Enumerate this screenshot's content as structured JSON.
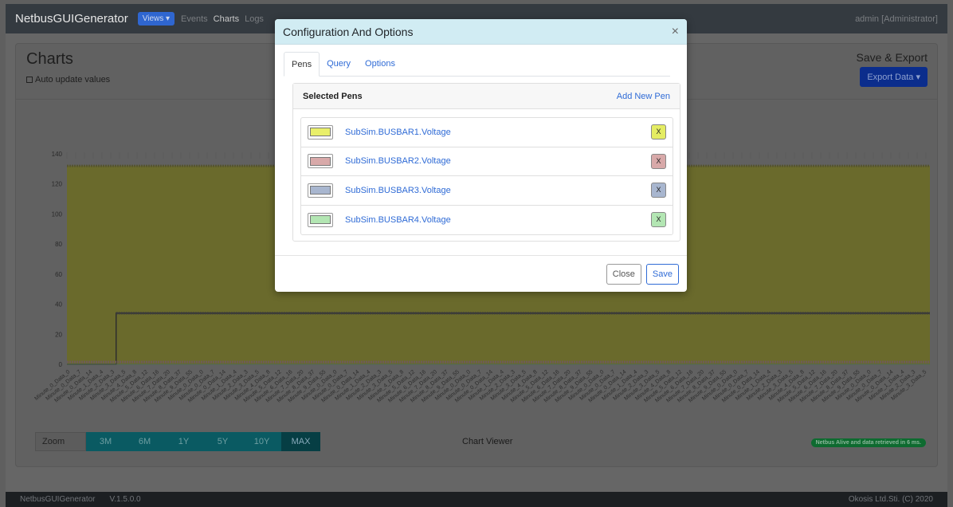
{
  "navbar": {
    "brand": "NetbusGUIGenerator",
    "views_label": "Views ▾",
    "links": [
      "Events",
      "Charts",
      "Logs"
    ],
    "user": "admin [Administrator]"
  },
  "page": {
    "title": "Charts",
    "auto_update_label": "Auto update values",
    "save_export_label": "Save & Export",
    "export_button": "Export Data ▾",
    "zoom_label": "Zoom",
    "zoom_options": [
      "3M",
      "6M",
      "1Y",
      "5Y",
      "10Y",
      "MAX"
    ],
    "zoom_active": "MAX",
    "chart_viewer_label": "Chart Viewer",
    "status_badge": "Netbus Alive and data retrieved in 6 ms."
  },
  "chart_data": {
    "type": "area",
    "yticks": [
      0,
      20,
      40,
      60,
      80,
      100,
      120,
      140
    ],
    "ylim": [
      0,
      140
    ],
    "x_label_samples": [
      "Minute_0_Data_0",
      "Minute_0_Data_7",
      "Minute_0_Data_14",
      "Minute_1_Data_4",
      "Minute_2_Data_3",
      "Minute_3_Data_5",
      "Minute_4_Data_8",
      "Minute_5_Data_12",
      "Minute_6_Data_16",
      "Minute_7_Data_20",
      "Minute_8_Data_37",
      "Minute_9_Data_55"
    ],
    "series": [
      {
        "name": "SubSim.BUSBAR1.Voltage",
        "level": 132,
        "color": "#c8c84a"
      },
      {
        "name": "SubSim.BUSBAR2.Voltage",
        "level": 1,
        "color": "#c08a8a"
      },
      {
        "name": "SubSim.BUSBAR3.Voltage",
        "level": 34,
        "start_fraction": 0.057,
        "color": "#8a96b0"
      },
      {
        "name": "SubSim.BUSBAR4.Voltage",
        "level": 0,
        "color": "#7fc08a"
      }
    ]
  },
  "footer": {
    "app": "NetbusGUIGenerator",
    "version": "V.1.5.0.0",
    "copyright": "Okosis Ltd.Sti. (C) 2020"
  },
  "modal": {
    "title": "Configuration And Options",
    "close_icon": "×",
    "tabs": [
      "Pens",
      "Query",
      "Options"
    ],
    "active_tab": "Pens",
    "selected_pens_title": "Selected Pens",
    "add_new_pen": "Add New Pen",
    "pens": [
      {
        "name": "SubSim.BUSBAR1.Voltage",
        "color": "#e9ef6a",
        "remove_bg": "#e4ec63",
        "remove_label": "X"
      },
      {
        "name": "SubSim.BUSBAR2.Voltage",
        "color": "#d8a9a9",
        "remove_bg": "#d8a9a9",
        "remove_label": "X"
      },
      {
        "name": "SubSim.BUSBAR3.Voltage",
        "color": "#a8b6cf",
        "remove_bg": "#a8b6cf",
        "remove_label": "X"
      },
      {
        "name": "SubSim.BUSBAR4.Voltage",
        "color": "#b3e6b3",
        "remove_bg": "#b3e6b3",
        "remove_label": "X"
      }
    ],
    "close_button": "Close",
    "save_button": "Save"
  }
}
